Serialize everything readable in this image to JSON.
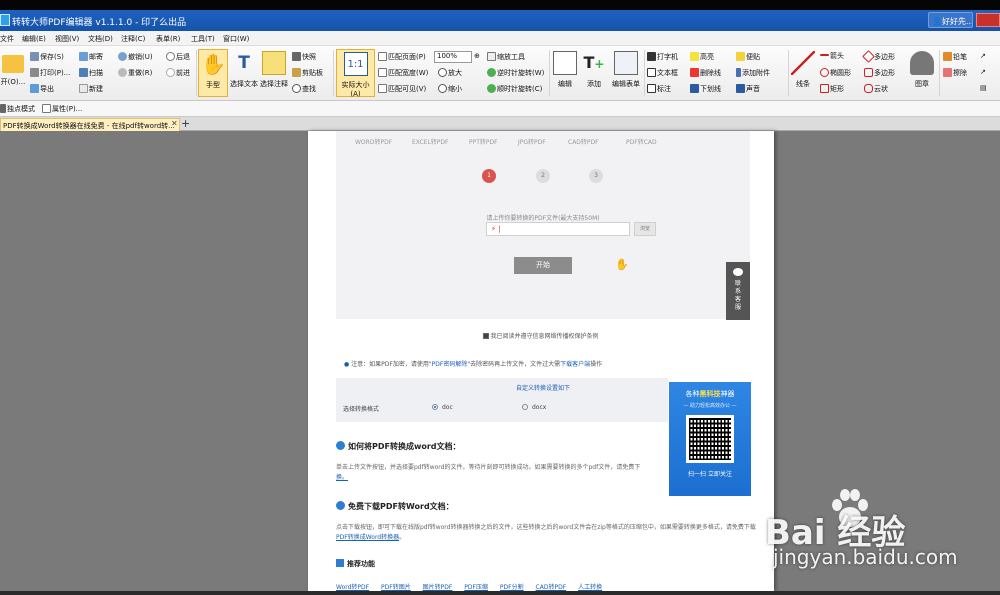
{
  "app": {
    "title": "转转大师PDF编辑器 v1.1.1.0 - 印了么出品",
    "user": "好好先..."
  },
  "menu": [
    "文件",
    "编辑(E)",
    "视图(V)",
    "文档(D)",
    "注释(C)",
    "表单(R)",
    "工具(T)",
    "窗口(W)"
  ],
  "ribbon": {
    "open": "开(O)...",
    "save": "保存(S)",
    "print": "打印(P)...",
    "export": "导出",
    "mail": "邮寄",
    "scan": "扫描",
    "new": "新建",
    "undo": "撤销(U)",
    "redo": "重做(R)",
    "back": "后退",
    "forward": "前进",
    "hand": "手型",
    "select_text": "选择文本",
    "select_annot": "选择注释",
    "snapshot": "快照",
    "clipboard": "剪贴板",
    "find": "查找",
    "actual_size": "实际大小(A)",
    "fit_page": "匹配页面(P)",
    "fit_width": "匹配宽度(W)",
    "fit_visible": "匹配可见(V)",
    "zoom_value": "100%",
    "zoom_in": "放大",
    "zoom_out": "缩小",
    "zoom_tool": "缩放工具",
    "rotate_cw": "逆时针旋转(W)",
    "rotate_ccw": "顺时针旋转(C)",
    "edit": "编辑",
    "add": "添加",
    "edit_form": "编辑表单",
    "typewriter": "打字机",
    "textbox": "文本框",
    "callout": "标注",
    "highlight": "高亮",
    "strikeout": "删除线",
    "underline": "下划线",
    "note": "便贴",
    "attach": "添加附件",
    "sound": "声音",
    "line": "线条",
    "arrow": "箭头",
    "ellipse": "椭圆形",
    "rect": "矩形",
    "polygon": "多边形",
    "polyline": "多边形",
    "cloud": "云状",
    "stamp": "图章",
    "pencil": "铅笔",
    "eraser": "擦除"
  },
  "quickbar": {
    "single_mode": "独点模式",
    "properties": "属性(P)..."
  },
  "tab": {
    "label": "PDF转换成Word转换器在线免费 - 在线pdf转word转..."
  },
  "page": {
    "convert_tabs": [
      "WORD转PDF",
      "EXCEL转PDF",
      "PPT转PDF",
      "JPG转PDF",
      "CAD转PDF",
      "PDF转CAD"
    ],
    "steps": [
      "1",
      "2",
      "3"
    ],
    "upload_hint": "请上传你要转换的PDF文件(最大支持50M)",
    "browse": "浏览",
    "start": "开始",
    "service": "联系客服",
    "agree": "我已阅读并遵守信息网络传播权保护条例",
    "note": "注意：如果PDF加密，请使用",
    "note_link": "\"PDF密码解除\"",
    "note_tail": "去除密码再上传文件，文件过大需",
    "note_link2": "下载客户端",
    "note_end": "操作",
    "settings_title": "自定义转换设置如下",
    "settings_label": "选择转换格式",
    "option_doc": "doc",
    "option_docx": "docx",
    "howto_title": "如何将PDF转换成word文档：",
    "howto_text": "单击上传文件按钮，并选择要pdf转word的文件。等待片刻即可转换成功。如果需要转换的多个pdf文件，请免费下",
    "howto_link": "换。",
    "free_title": "免费下载PDF转Word文档：",
    "free_text": "点击下载按钮，即可下载在线版pdf转word转换器转换之后的文件，这些转换之后的word文件会在zip等格式的压缩包中，如果需要转换更多格式，请免费下载",
    "free_link": "PDF转换成Word转换器",
    "free_end": "。",
    "recommend": "推荐功能",
    "rec_links": [
      "Word转PDF",
      "PDF转图片",
      "图片转PDF",
      "PDF压缩",
      "PDF分割",
      "CAD转PDF",
      "人工转换"
    ]
  },
  "qr": {
    "head_pre": "各种",
    "head_hl": "黑科技",
    "head_post": "神器",
    "sub": "— 助力轻松高效办公 —",
    "foot": "扫一扫 立即关注"
  },
  "watermark": {
    "brand": "Bai  经验",
    "url": "jingyan.baidu.com"
  },
  "colors": {
    "title_blue": "#1e62c0",
    "step_active": "#d9534f",
    "link": "#1a5fb4",
    "qr_bg": "#2f86e3"
  }
}
